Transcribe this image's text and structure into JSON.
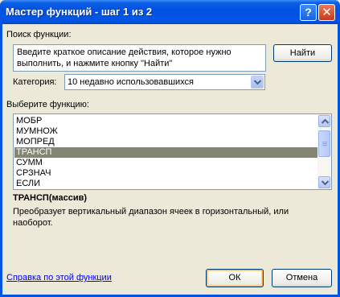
{
  "window": {
    "title": "Мастер функций - шаг 1 из 2",
    "help_button": "?",
    "close_button": "✕"
  },
  "search": {
    "label": "Поиск функции:",
    "text": "Введите краткое описание действия, которое нужно выполнить, и нажмите кнопку \"Найти\"",
    "find_button": "Найти"
  },
  "category": {
    "label": "Категория:",
    "selected": "10 недавно использовавшихся"
  },
  "functions": {
    "label": "Выберите функцию:",
    "items": [
      "МОБР",
      "МУМНОЖ",
      "МОПРЕД",
      "ТРАНСП",
      "СУММ",
      "СРЗНАЧ",
      "ЕСЛИ"
    ],
    "selected_index": 3
  },
  "details": {
    "signature": "ТРАНСП(массив)",
    "description": "Преобразует вертикальный диапазон ячеек в горизонтальный, или наоборот."
  },
  "footer": {
    "help_link": "Справка по этой функции",
    "ok_button": "ОК",
    "cancel_button": "Отмена"
  },
  "colors": {
    "title_bar": "#0151E0",
    "selection": "#858574",
    "dialog_bg": "#ECE9D8",
    "link": "#0000FF"
  }
}
